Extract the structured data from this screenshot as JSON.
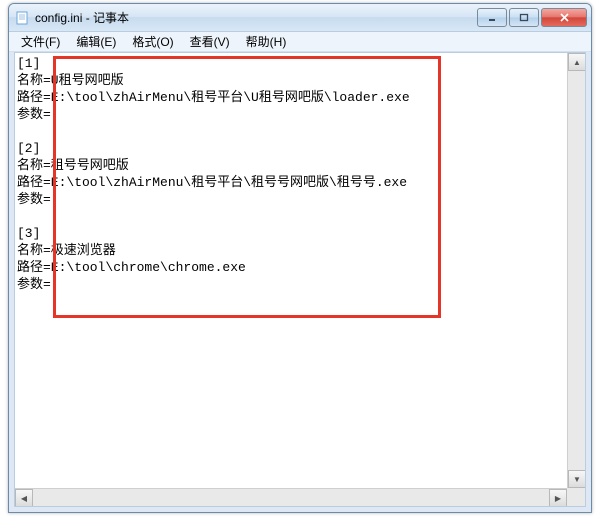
{
  "window": {
    "title": "config.ini - 记事本"
  },
  "menubar": {
    "file": "文件(F)",
    "edit": "编辑(E)",
    "format": "格式(O)",
    "view": "查看(V)",
    "help": "帮助(H)"
  },
  "content": "[1]\n名称=U租号网吧版\n路径=E:\\tool\\zhAirMenu\\租号平台\\U租号网吧版\\loader.exe\n参数=\n\n[2]\n名称=租号号网吧版\n路径=E:\\tool\\zhAirMenu\\租号平台\\租号号网吧版\\租号号.exe\n参数=\n\n[3]\n名称=极速浏览器\n路径=E:\\tool\\chrome\\chrome.exe\n参数=",
  "scroll": {
    "up": "▲",
    "down": "▼",
    "left": "◀",
    "right": "▶"
  }
}
